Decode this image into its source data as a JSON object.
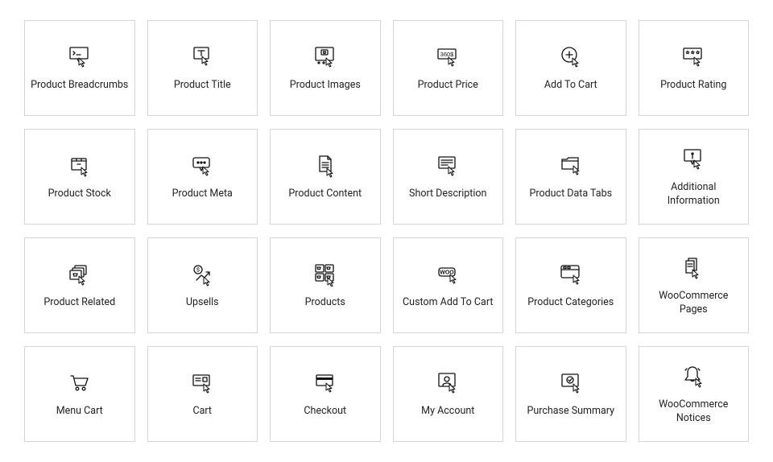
{
  "widgets": [
    {
      "id": "product-breadcrumbs",
      "label": "Product Breadcrumbs",
      "icon": "breadcrumbs"
    },
    {
      "id": "product-title",
      "label": "Product Title",
      "icon": "title"
    },
    {
      "id": "product-images",
      "label": "Product Images",
      "icon": "images"
    },
    {
      "id": "product-price",
      "label": "Product Price",
      "icon": "price"
    },
    {
      "id": "add-to-cart",
      "label": "Add To Cart",
      "icon": "addcart"
    },
    {
      "id": "product-rating",
      "label": "Product Rating",
      "icon": "rating"
    },
    {
      "id": "product-stock",
      "label": "Product Stock",
      "icon": "stock"
    },
    {
      "id": "product-meta",
      "label": "Product Meta",
      "icon": "meta"
    },
    {
      "id": "product-content",
      "label": "Product Content",
      "icon": "content"
    },
    {
      "id": "short-description",
      "label": "Short Description",
      "icon": "shortdesc"
    },
    {
      "id": "product-data-tabs",
      "label": "Product Data Tabs",
      "icon": "tabs"
    },
    {
      "id": "additional-information",
      "label": "Additional Information",
      "icon": "info"
    },
    {
      "id": "product-related",
      "label": "Product Related",
      "icon": "related"
    },
    {
      "id": "upsells",
      "label": "Upsells",
      "icon": "upsells"
    },
    {
      "id": "products",
      "label": "Products",
      "icon": "products"
    },
    {
      "id": "custom-add-to-cart",
      "label": "Custom Add To Cart",
      "icon": "woo"
    },
    {
      "id": "product-categories",
      "label": "Product Categories",
      "icon": "categories"
    },
    {
      "id": "woocommerce-pages",
      "label": "WooCommerce Pages",
      "icon": "pages"
    },
    {
      "id": "menu-cart",
      "label": "Menu Cart",
      "icon": "menucart"
    },
    {
      "id": "cart",
      "label": "Cart",
      "icon": "cart"
    },
    {
      "id": "checkout",
      "label": "Checkout",
      "icon": "checkout"
    },
    {
      "id": "my-account",
      "label": "My Account",
      "icon": "account"
    },
    {
      "id": "purchase-summary",
      "label": "Purchase Summary",
      "icon": "summary"
    },
    {
      "id": "woocommerce-notices",
      "label": "WooCommerce Notices",
      "icon": "notices"
    }
  ]
}
